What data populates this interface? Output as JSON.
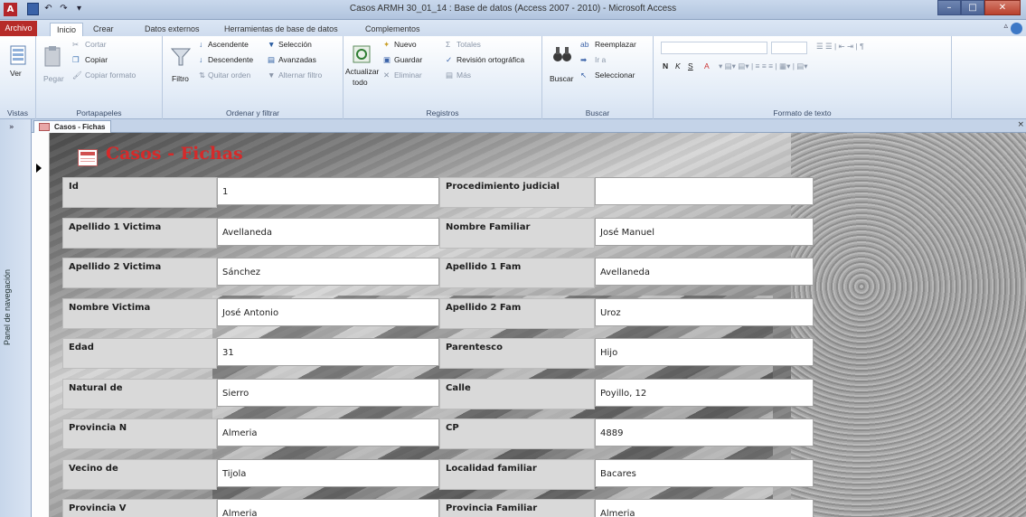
{
  "window": {
    "title": "Casos ARMH 30_01_14 : Base de datos (Access 2007 - 2010) - Microsoft Access",
    "app_icon": "A"
  },
  "tabs": [
    "Archivo",
    "Inicio",
    "Crear",
    "Datos externos",
    "Herramientas de base de datos",
    "Complementos"
  ],
  "ribbon": {
    "vistas": {
      "button": "Ver",
      "label": "Vistas"
    },
    "portapapeles": {
      "pegar": "Pegar",
      "cortar": "Cortar",
      "copiar": "Copiar",
      "copiar_formato": "Copiar formato",
      "label": "Portapapeles"
    },
    "ordenar": {
      "filtro": "Filtro",
      "ascendente": "Ascendente",
      "descendente": "Descendente",
      "quitar_orden": "Quitar orden",
      "seleccion": "Selección",
      "avanzadas": "Avanzadas",
      "alternar_filtro": "Alternar filtro",
      "label": "Ordenar y filtrar"
    },
    "registros": {
      "actualizar": "Actualizar",
      "todo": "todo",
      "nuevo": "Nuevo",
      "guardar": "Guardar",
      "eliminar": "Eliminar",
      "totales": "Totales",
      "revision": "Revisión ortográfica",
      "mas": "Más",
      "label": "Registros"
    },
    "buscar": {
      "buscar": "Buscar",
      "reemplazar": "Reemplazar",
      "ir_a": "Ir a",
      "seleccionar": "Seleccionar",
      "label": "Buscar"
    },
    "formato": {
      "label": "Formato de texto",
      "bold": "N",
      "italic": "K",
      "underline": "S",
      "fontcolor": "A"
    }
  },
  "nav_pane": {
    "label": "Panel de navegación",
    "toggle": "»"
  },
  "document_tab": {
    "label": "Casos - Fichas",
    "close": "×"
  },
  "form": {
    "title": "Casos - Fichas",
    "left_fields": [
      {
        "label": "Id",
        "value": "1"
      },
      {
        "label": "Apellido 1 Victima",
        "value": "Avellaneda"
      },
      {
        "label": "Apellido 2 Victima",
        "value": "Sánchez"
      },
      {
        "label": "Nombre Victima",
        "value": "José Antonio"
      },
      {
        "label": "Edad",
        "value": "31"
      },
      {
        "label": "Natural de",
        "value": "Sierro"
      },
      {
        "label": "Provincia N",
        "value": "Almeria"
      },
      {
        "label": "Vecino de",
        "value": "Tijola"
      },
      {
        "label": "Provincia V",
        "value": "Almeria"
      }
    ],
    "right_fields": [
      {
        "label": "Procedimiento judicial",
        "value": ""
      },
      {
        "label": "Nombre Familiar",
        "value": "José Manuel"
      },
      {
        "label": "Apellido 1 Fam",
        "value": "Avellaneda"
      },
      {
        "label": "Apellido 2 Fam",
        "value": "Uroz"
      },
      {
        "label": "Parentesco",
        "value": "Hijo"
      },
      {
        "label": "Calle",
        "value": "Poyillo, 12"
      },
      {
        "label": "CP",
        "value": "4889"
      },
      {
        "label": "Localidad familiar",
        "value": "Bacares"
      },
      {
        "label": "Provincia Familiar",
        "value": "Almeria"
      }
    ]
  },
  "colors": {
    "title_red": "#d52a2a",
    "file_tab": "#b62b28",
    "ribbon_bg": "#e3ecf7"
  }
}
